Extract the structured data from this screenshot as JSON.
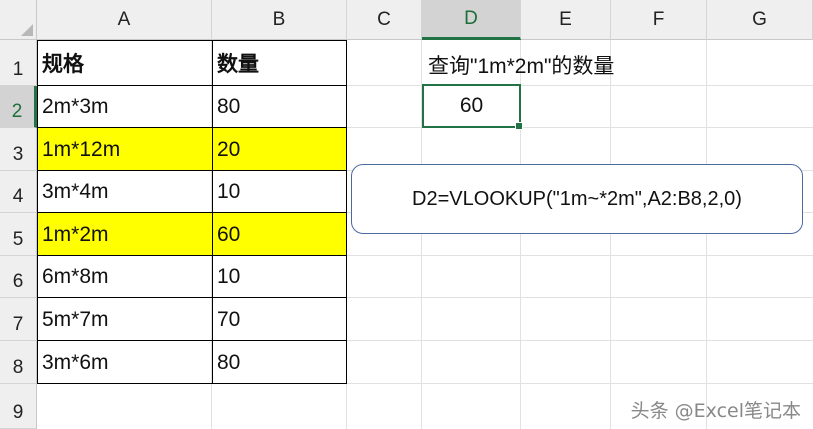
{
  "columns": [
    "A",
    "B",
    "C",
    "D",
    "E",
    "F",
    "G"
  ],
  "selected_column": "D",
  "rows": [
    "1",
    "2",
    "3",
    "4",
    "5",
    "6",
    "7",
    "8",
    "9"
  ],
  "selected_row": "2",
  "table": {
    "headers": [
      "规格",
      "数量"
    ],
    "data": [
      {
        "spec": "2m*3m",
        "qty": "80",
        "highlight": false
      },
      {
        "spec": "1m*12m",
        "qty": "20",
        "highlight": true
      },
      {
        "spec": "3m*4m",
        "qty": "10",
        "highlight": false
      },
      {
        "spec": "1m*2m",
        "qty": "60",
        "highlight": true
      },
      {
        "spec": "6m*8m",
        "qty": "10",
        "highlight": false
      },
      {
        "spec": "5m*7m",
        "qty": "70",
        "highlight": false
      },
      {
        "spec": "3m*6m",
        "qty": "80",
        "highlight": false
      }
    ]
  },
  "query_label": "查询\"1m*2m\"的数量",
  "result_value": "60",
  "formula": "D2=VLOOKUP(\"1m~*2m\",A2:B8,2,0)",
  "watermark": "头条 @Excel笔记本",
  "colors": {
    "highlight": "#ffff00",
    "selection": "#217346",
    "formula_box_border": "#4a6aa0"
  }
}
